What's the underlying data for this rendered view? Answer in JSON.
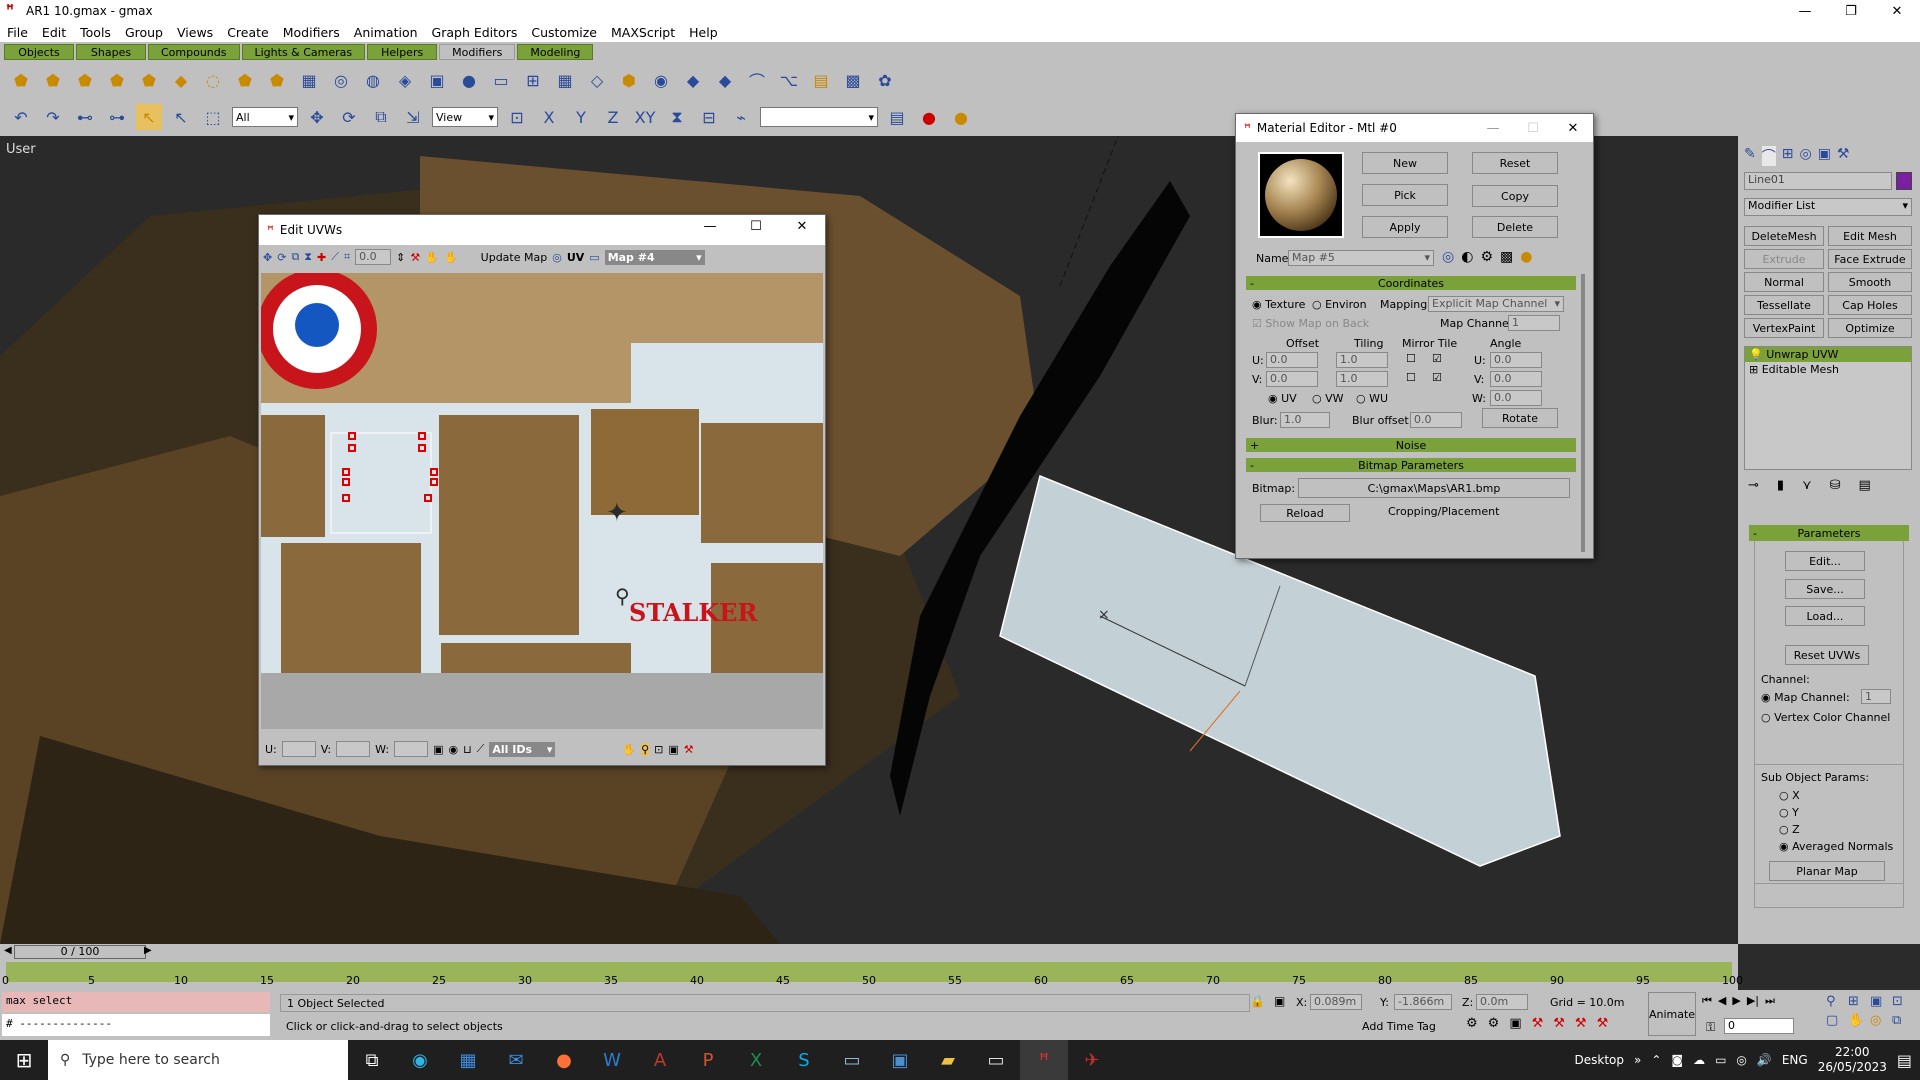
{
  "window": {
    "title": "AR1 10.gmax - gmax",
    "minimize": "—",
    "maximize": "❐",
    "close": "✕"
  },
  "menu": [
    "File",
    "Edit",
    "Tools",
    "Group",
    "Views",
    "Create",
    "Modifiers",
    "Animation",
    "Graph Editors",
    "Customize",
    "MAXScript",
    "Help"
  ],
  "tabs": [
    "Objects",
    "Shapes",
    "Compounds",
    "Lights & Cameras",
    "Helpers",
    "Modifiers",
    "Modeling"
  ],
  "active_tab": "Modifiers",
  "toolbar": {
    "selection_filter": "All",
    "ref_coord": "View",
    "named_sel": ""
  },
  "viewport": {
    "label": "User"
  },
  "edit_uvws": {
    "title": "Edit UVWs",
    "spinner": "0.0",
    "update_map": "Update Map",
    "uv_label": "UV",
    "map_select": "Map #4",
    "u_label": "U:",
    "v_label": "V:",
    "w_label": "W:",
    "ids": "All IDs",
    "texture_text": "STALKER",
    "min": "—",
    "max": "☐",
    "close": "✕"
  },
  "material_editor": {
    "title": "Material Editor - Mtl #0",
    "new": "New",
    "reset": "Reset",
    "pick": "Pick",
    "copy": "Copy",
    "apply": "Apply",
    "delete": "Delete",
    "name_label": "Name",
    "name_value": "Map #5",
    "coordinates_title": "Coordinates",
    "texture": "Texture",
    "environ": "Environ",
    "mapping_label": "Mapping:",
    "mapping_value": "Explicit Map Channel",
    "show_map_on_back": "Show Map on Back",
    "map_channel_label": "Map Channel:",
    "map_channel_value": "1",
    "offset": "Offset",
    "tiling": "Tiling",
    "mirror_tile": "Mirror Tile",
    "angle": "Angle",
    "u": "U:",
    "v": "V:",
    "w": "W:",
    "offset_u": "0.0",
    "offset_v": "0.0",
    "tiling_u": "1.0",
    "tiling_v": "1.0",
    "angle_u": "0.0",
    "angle_v": "0.0",
    "angle_w": "0.0",
    "uv": "UV",
    "vw": "VW",
    "wu": "WU",
    "blur_label": "Blur:",
    "blur_value": "1.0",
    "blur_offset_label": "Blur offset:",
    "blur_offset_value": "0.0",
    "rotate": "Rotate",
    "noise": "Noise",
    "bitmap_params": "Bitmap Parameters",
    "bitmap_label": "Bitmap:",
    "bitmap_path": "C:\\gmax\\Maps\\AR1.bmp",
    "reload": "Reload",
    "cropping": "Cropping/Placement",
    "plus": "+",
    "minus": "-"
  },
  "command_panel": {
    "object_name": "Line01",
    "object_color": "#7a1fa2",
    "modifier_list": "Modifier List",
    "buttons": [
      "DeleteMesh",
      "Edit Mesh",
      "Extrude",
      "Face Extrude",
      "Normal",
      "Smooth",
      "Tessellate",
      "Cap Holes",
      "VertexPaint",
      "Optimize"
    ],
    "stack": [
      "Unwrap UVW",
      "Editable Mesh"
    ],
    "parameters": "Parameters",
    "edit": "Edit...",
    "save": "Save...",
    "load": "Load...",
    "reset_uvws": "Reset UVWs",
    "channel": "Channel:",
    "map_channel": "Map Channel:",
    "map_channel_value": "1",
    "vertex_color_channel": "Vertex Color Channel",
    "sub_object_params": "Sub Object Params:",
    "x": "X",
    "y": "Y",
    "z": "Z",
    "averaged_normals": "Averaged Normals",
    "planar_map": "Planar Map"
  },
  "timeline": {
    "frame": "0 / 100",
    "ticks": [
      "0",
      "5",
      "10",
      "15",
      "20",
      "25",
      "30",
      "35",
      "40",
      "45",
      "50",
      "55",
      "60",
      "65",
      "70",
      "75",
      "80",
      "85",
      "90",
      "95",
      "100"
    ]
  },
  "status": {
    "script_line1": "max select",
    "script_line2": "# --------------",
    "selected": "1 Object Selected",
    "prompt": "Click or click-and-drag to select objects",
    "x_label": "X:",
    "x_value": "0.089m",
    "y_label": "Y:",
    "y_value": "-1.866m",
    "z_label": "Z:",
    "z_value": "0.0m",
    "grid": "Grid = 10.0m",
    "add_time_tag": "Add Time Tag",
    "animate": "Animate",
    "frame_value": "0"
  },
  "taskbar": {
    "search_placeholder": "Type here to search",
    "desktop": "Desktop",
    "lang": "ENG",
    "time": "22:00",
    "date": "26/05/2023",
    "apps": [
      "task-view",
      "edge",
      "store",
      "mail",
      "firefox",
      "word",
      "access",
      "powerpoint",
      "excel",
      "skype",
      "network-drive",
      "control-panel",
      "file-explorer",
      "window",
      "gmax",
      "game"
    ]
  },
  "colors": {
    "ui_gray": "#c0c0c0",
    "accent_green": "#7ba23a",
    "uv_selection_red": "#e00000"
  }
}
